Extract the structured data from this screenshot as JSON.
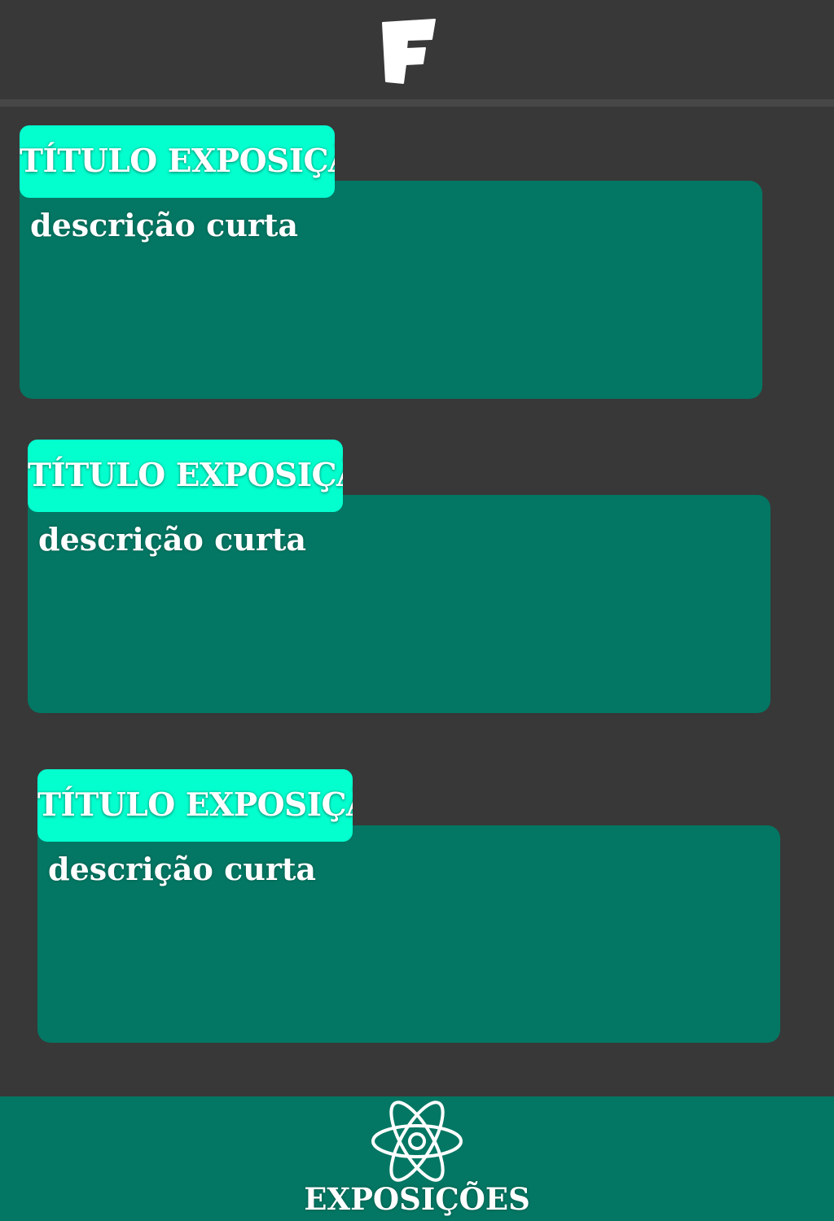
{
  "header": {
    "logo_icon": "f-logo-icon"
  },
  "exhibitions": [
    {
      "title": "TÍTULO EXPOSIÇÃO",
      "description": "descrição curta"
    },
    {
      "title": "TÍTULO EXPOSIÇÃO",
      "description": "descrição curta"
    },
    {
      "title": "TÍTULO EXPOSIÇÃO",
      "description": "descrição curta"
    }
  ],
  "bottom_nav": {
    "items": [
      {
        "label": "EXPOSIÇÕES",
        "icon": "atom-icon"
      }
    ]
  },
  "colors": {
    "background": "#383838",
    "card": "#037763",
    "title_tag": "#04ffcf",
    "text": "#ffffff"
  }
}
